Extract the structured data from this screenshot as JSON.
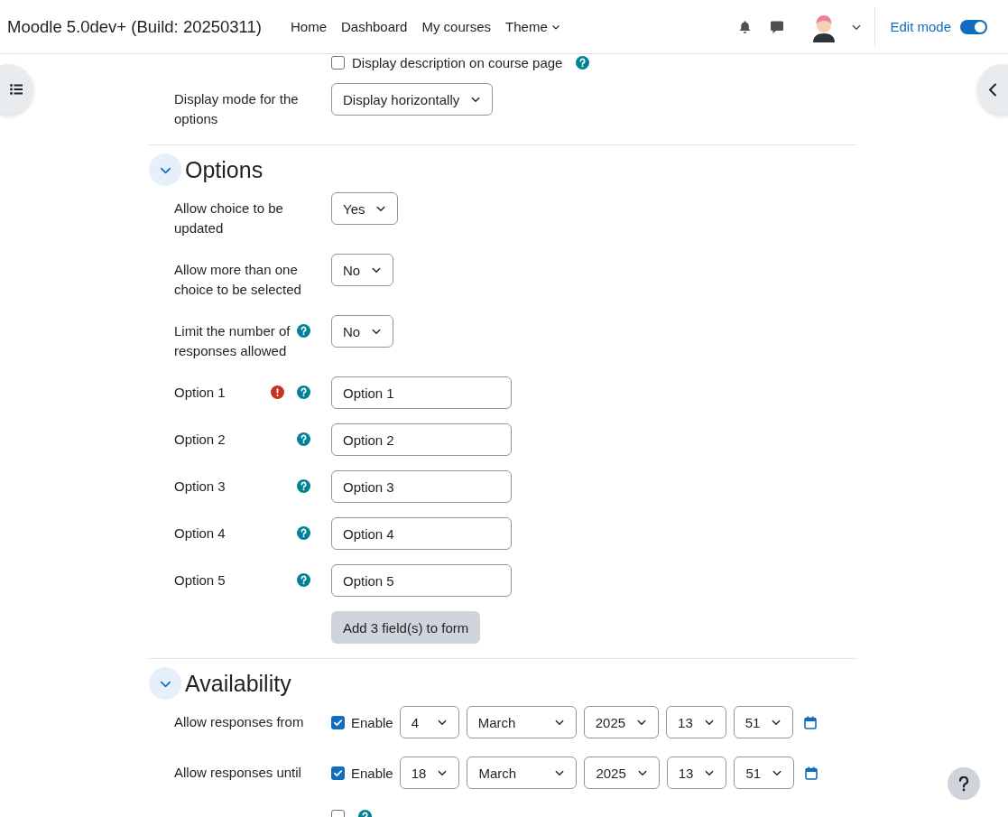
{
  "navbar": {
    "brand": "Moodle 5.0dev+ (Build: 20250311)",
    "nav_items": [
      {
        "label": "Home",
        "kind": "link"
      },
      {
        "label": "Dashboard",
        "kind": "link"
      },
      {
        "label": "My courses",
        "kind": "link"
      },
      {
        "label": "Theme",
        "kind": "dropdown"
      }
    ],
    "edit_mode": {
      "label": "Edit mode",
      "on": true
    }
  },
  "form": {
    "top_rows": [
      {
        "kind": "checkbox",
        "text": "Display description on course page",
        "checked": false,
        "help": true
      },
      {
        "kind": "select",
        "label": "Display mode for the options",
        "value": "Display horizontally"
      }
    ],
    "sections": [
      {
        "title": "Options",
        "expanded": true,
        "rows": [
          {
            "kind": "select",
            "label": "Allow choice to be updated",
            "value": "Yes"
          },
          {
            "kind": "select",
            "label": "Allow more than one choice to be selected",
            "value": "No"
          },
          {
            "kind": "select",
            "label": "Limit the number of responses allowed",
            "value": "No",
            "help": true
          },
          {
            "kind": "text",
            "label": "Option 1",
            "value": "Option 1",
            "error": true,
            "help": true
          },
          {
            "kind": "text",
            "label": "Option 2",
            "value": "Option 2",
            "help": true
          },
          {
            "kind": "text",
            "label": "Option 3",
            "value": "Option 3",
            "help": true
          },
          {
            "kind": "text",
            "label": "Option 4",
            "value": "Option 4",
            "help": true
          },
          {
            "kind": "text",
            "label": "Option 5",
            "value": "Option 5",
            "help": true
          },
          {
            "kind": "button",
            "text": "Add 3 field(s) to form"
          }
        ]
      },
      {
        "title": "Availability",
        "expanded": true,
        "rows": [
          {
            "kind": "datetime",
            "label": "Allow responses from",
            "enabled": true,
            "enable_label": "Enable",
            "fields": [
              "4",
              "March",
              "2025",
              "13",
              "51"
            ]
          },
          {
            "kind": "datetime",
            "label": "Allow responses until",
            "enabled": true,
            "enable_label": "Enable",
            "fields": [
              "18",
              "March",
              "2025",
              "13",
              "51"
            ]
          },
          {
            "kind": "checkbox",
            "checked": false,
            "help": true
          }
        ]
      }
    ]
  }
}
